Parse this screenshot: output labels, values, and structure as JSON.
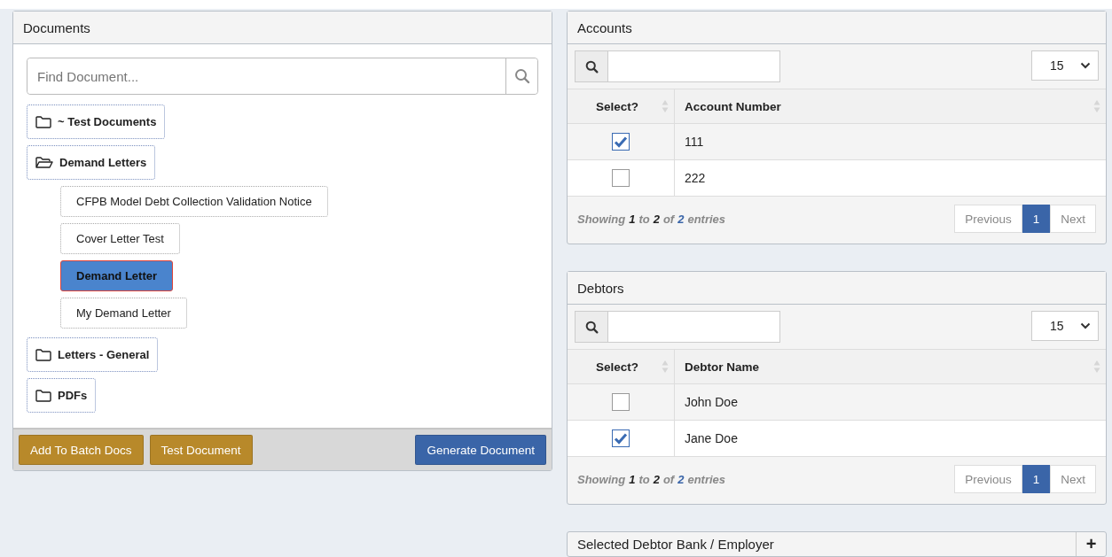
{
  "documents": {
    "title": "Documents",
    "search": {
      "placeholder": "Find Document..."
    },
    "tree": [
      {
        "label": "~ Test Documents",
        "expanded": false
      },
      {
        "label": "Demand Letters",
        "expanded": true,
        "children": [
          {
            "label": "CFPB Model Debt Collection Validation Notice",
            "selected": false
          },
          {
            "label": "Cover Letter Test",
            "selected": false
          },
          {
            "label": "Demand Letter",
            "selected": true
          },
          {
            "label": "My Demand Letter",
            "selected": false
          }
        ]
      },
      {
        "label": "Letters - General",
        "expanded": false
      },
      {
        "label": "PDFs",
        "expanded": false
      }
    ],
    "buttons": [
      {
        "label": "Add To Batch Docs",
        "kind": "warning"
      },
      {
        "label": "Test Document",
        "kind": "warning"
      },
      {
        "label": "Generate Document",
        "kind": "primary"
      }
    ]
  },
  "tables": [
    {
      "title": "Accounts",
      "page_size": "15",
      "columns": [
        "Select?",
        "Account Number"
      ],
      "rows": [
        {
          "checked": true,
          "value": "111"
        },
        {
          "checked": false,
          "value": "222"
        }
      ],
      "info": [
        {
          "text": "Showing",
          "kind": "label"
        },
        {
          "text": "1",
          "kind": "number"
        },
        {
          "text": "to",
          "kind": "label"
        },
        {
          "text": "2",
          "kind": "number"
        },
        {
          "text": "of",
          "kind": "label"
        },
        {
          "text": "2",
          "kind": "total"
        },
        {
          "text": "entries",
          "kind": "label"
        }
      ],
      "pagination": [
        {
          "label": "Previous",
          "selected": false
        },
        {
          "label": "1",
          "selected": true
        },
        {
          "label": "Next",
          "selected": false
        }
      ]
    },
    {
      "title": "Debtors",
      "page_size": "15",
      "columns": [
        "Select?",
        "Debtor Name"
      ],
      "rows": [
        {
          "checked": false,
          "value": "John Doe"
        },
        {
          "checked": true,
          "value": "Jane Doe"
        }
      ],
      "info": [
        {
          "text": "Showing",
          "kind": "label"
        },
        {
          "text": "1",
          "kind": "number"
        },
        {
          "text": "to",
          "kind": "label"
        },
        {
          "text": "2",
          "kind": "number"
        },
        {
          "text": "of",
          "kind": "label"
        },
        {
          "text": "2",
          "kind": "total"
        },
        {
          "text": "entries",
          "kind": "label"
        }
      ],
      "pagination": [
        {
          "label": "Previous",
          "selected": false
        },
        {
          "label": "1",
          "selected": true
        },
        {
          "label": "Next",
          "selected": false
        }
      ]
    }
  ],
  "collapsed_panel": {
    "title": "Selected Debtor Bank / Employer",
    "toggle": "+"
  }
}
